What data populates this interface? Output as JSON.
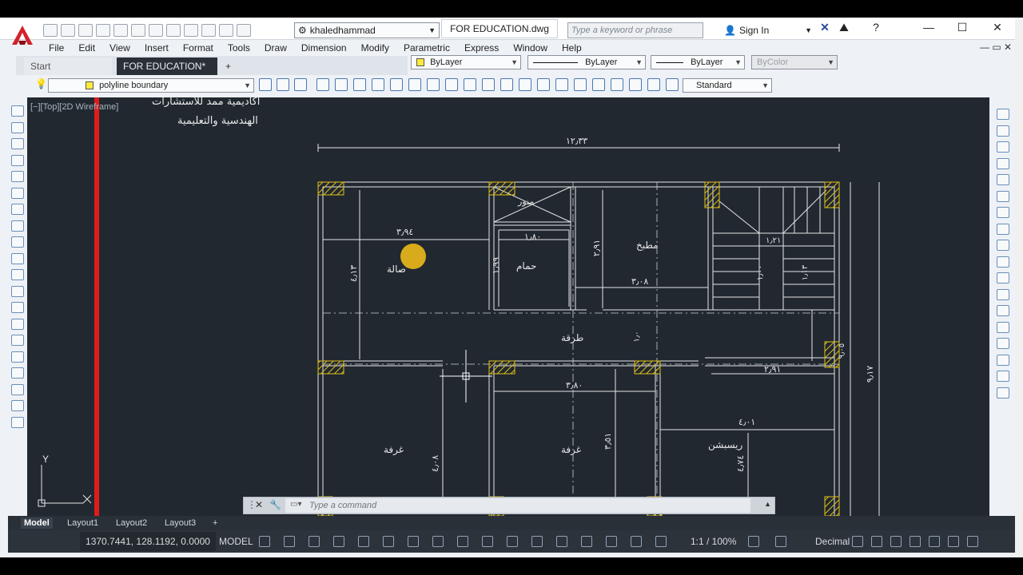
{
  "app": {
    "workspace": "khaledhammad",
    "document_title": "FOR EDUCATION.dwg",
    "search_placeholder": "Type a keyword or phrase",
    "sign_in": "Sign In"
  },
  "menu": [
    "File",
    "Edit",
    "View",
    "Insert",
    "Format",
    "Tools",
    "Draw",
    "Dimension",
    "Modify",
    "Parametric",
    "Express",
    "Window",
    "Help"
  ],
  "tabs": {
    "start": "Start",
    "active": "FOR EDUCATION*",
    "new_tab": "+"
  },
  "properties": {
    "color": "ByLayer",
    "linetype": "ByLayer",
    "lineweight": "ByLayer",
    "plotstyle": "ByColor"
  },
  "layer": {
    "current": "polyline boundary"
  },
  "dimstyle": {
    "current": "Standard"
  },
  "viewport": {
    "label": "[−][Top][2D Wireframe]"
  },
  "drawing": {
    "header_line1": "اكاديمية ممد للاستشارات",
    "header_line2": "الهندسية والتعليمية",
    "overall_width": "١٢٫٣٣",
    "rooms": {
      "living": "صالة",
      "bath": "حمام",
      "kitchen": "مطبخ",
      "corridor": "طرقة",
      "room_left": "غرفة",
      "room_mid": "غرفة",
      "reception": "ريسبشن",
      "shaft": "منور"
    },
    "dims": {
      "living_w": "٣٫٩٤",
      "living_h": "٤٫١٣",
      "bath_w": "١٫٨٠",
      "bath_h": "١٫٩٩",
      "kitchen_h": "٢٫٩١",
      "kitchen_w": "٣٫٠٨",
      "stair_a": "١٫٢١",
      "stair_b": "١٫٠٠",
      "stair_c": "١٫١٣",
      "corr_h": "١٫٠",
      "right_w": "٢٫٩١",
      "mid_w": "٣٫٨٠",
      "rec_w": "٤٫٠١",
      "rec_h": "٤٫٧٤",
      "mid_h": "٣٫٥١",
      "left_h": "٤٫٠٨",
      "side_a": "٩٫٠٥",
      "total_h": "٩٫١٧"
    }
  },
  "command": {
    "placeholder": "Type  a  command"
  },
  "layouts": [
    "Model",
    "Layout1",
    "Layout2",
    "Layout3",
    "+"
  ],
  "status": {
    "coordinates": "1370.7441, 128.1192, 0.0000",
    "mode": "MODEL",
    "scale": "1:1 / 100%",
    "units": "Decimal"
  },
  "colors": {
    "canvas": "#212830",
    "accent_red": "#e11b1b",
    "autocad_red": "#d3222a",
    "cursor_dot": "#e2b21a"
  }
}
